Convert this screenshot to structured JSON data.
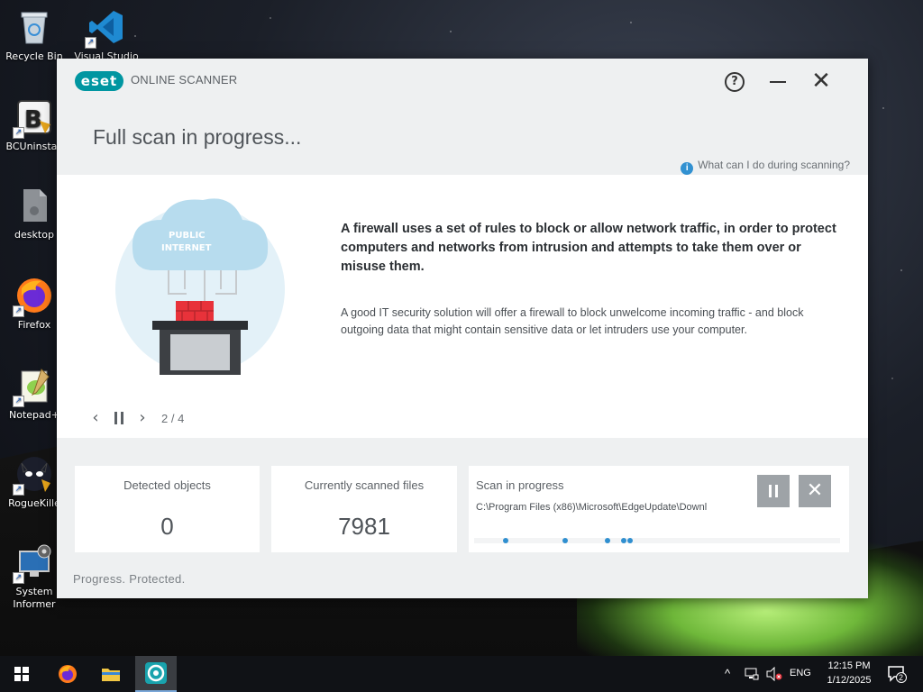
{
  "desktop": {
    "icons": [
      {
        "label": "Recycle Bin",
        "icon": "recycle-bin-icon"
      },
      {
        "label": "Visual Studio",
        "icon": "vscode-icon"
      },
      {
        "label": "BCUninstall",
        "icon": "bcuninstaller-icon"
      },
      {
        "label": "desktop",
        "icon": "file-icon"
      },
      {
        "label": "Firefox",
        "icon": "firefox-icon"
      },
      {
        "label": "Notepad+",
        "icon": "notepadplusplus-icon"
      },
      {
        "label": "RogueKille",
        "icon": "roguekiller-icon"
      },
      {
        "label": "System Informer",
        "icon": "system-informer-icon"
      }
    ]
  },
  "window": {
    "logo_text": "eset",
    "app_name": "ONLINE SCANNER",
    "title": "Full scan in progress...",
    "help_link": "What can I do during scanning?",
    "colors": {
      "brand": "#0096a1",
      "accent": "#2f8fd0"
    }
  },
  "tip": {
    "illustration_label": "PUBLIC INTERNET",
    "heading": "A firewall uses a set of rules to block or allow network traffic, in order to protect computers and networks from intrusion and attempts to take them over or misuse them.",
    "body": "A good IT security solution will offer a firewall to block unwelcome incoming traffic - and block outgoing data that might contain sensitive data or let intruders use your computer.",
    "counter": "2 / 4"
  },
  "stats": {
    "detected_label": "Detected objects",
    "detected_value": "0",
    "files_label": "Currently scanned files",
    "files_value": "7981"
  },
  "progress": {
    "title": "Scan in progress",
    "path": "C:\\Program Files (x86)\\Microsoft\\EdgeUpdate\\Downl"
  },
  "footer": "Progress. Protected.",
  "taskbar": {
    "lang": "ENG",
    "time": "12:15 PM",
    "date": "1/12/2025",
    "notifications": "2"
  }
}
